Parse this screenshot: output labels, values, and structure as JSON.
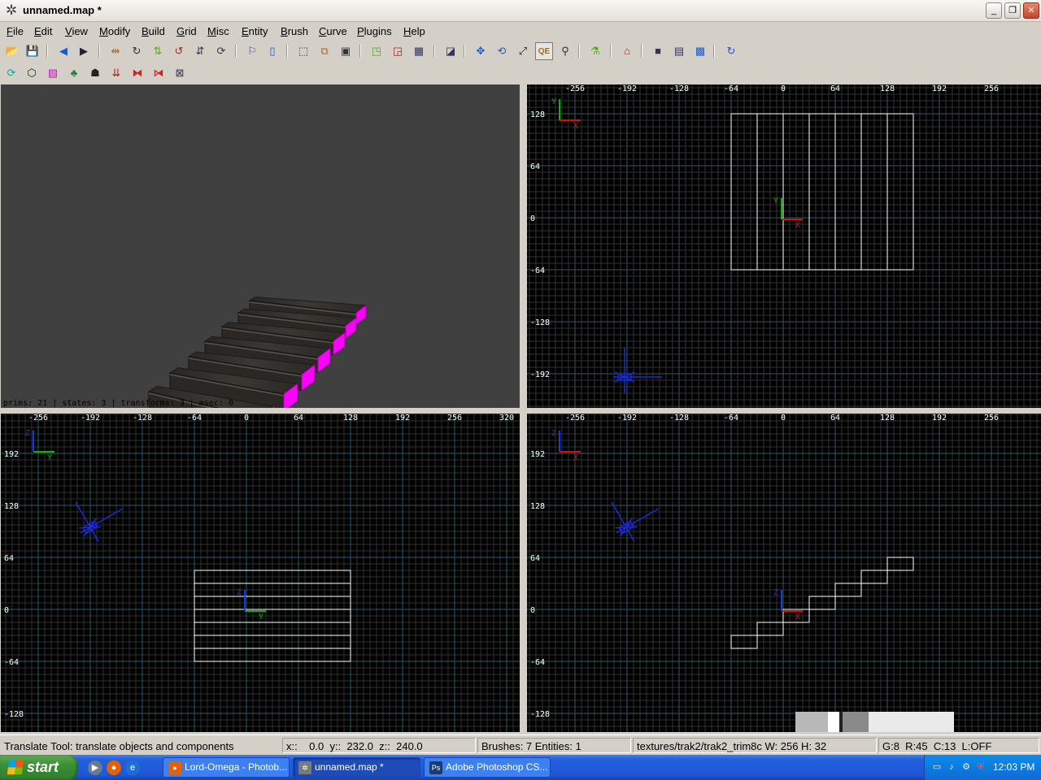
{
  "window": {
    "title": "unnamed.map *",
    "app_icon": "gear-icon",
    "controls": {
      "minimize": "_",
      "maximize": "❐",
      "close": "✕"
    }
  },
  "menu": [
    "File",
    "Edit",
    "View",
    "Modify",
    "Build",
    "Grid",
    "Misc",
    "Entity",
    "Brush",
    "Curve",
    "Plugins",
    "Help"
  ],
  "toolbar1": [
    {
      "name": "open-icon",
      "glyph": "📂"
    },
    {
      "name": "save-icon",
      "glyph": "💾"
    },
    {
      "name": "undo-arrow-icon",
      "glyph": "◀"
    },
    {
      "name": "redo-arrow-icon",
      "glyph": "▶"
    },
    {
      "name": "flip-x-icon",
      "glyph": "⇹"
    },
    {
      "name": "rotate-x-icon",
      "glyph": "↻"
    },
    {
      "name": "flip-y-icon",
      "glyph": "⇅"
    },
    {
      "name": "rotate-y-icon",
      "glyph": "↺"
    },
    {
      "name": "flip-z-icon",
      "glyph": "⇵"
    },
    {
      "name": "rotate-z-icon",
      "glyph": "⟳"
    },
    {
      "name": "make-hollow-icon",
      "glyph": "⚐"
    },
    {
      "name": "entity-icon",
      "glyph": "▯"
    },
    {
      "name": "select-inside-icon",
      "glyph": "⬚"
    },
    {
      "name": "select-touching-icon",
      "glyph": "⧉"
    },
    {
      "name": "select-partial-icon",
      "glyph": "▣"
    },
    {
      "name": "clipper-icon",
      "glyph": "◳"
    },
    {
      "name": "csg-subtract-icon",
      "glyph": "◲"
    },
    {
      "name": "csg-merge-icon",
      "glyph": "▦"
    },
    {
      "name": "texture-lock-icon",
      "glyph": "◪"
    },
    {
      "name": "translate-tool-icon",
      "glyph": "✥"
    },
    {
      "name": "rotate-tool-icon",
      "glyph": "⟲"
    },
    {
      "name": "scale-tool-icon",
      "glyph": "⤢"
    },
    {
      "name": "qe-tool-button",
      "glyph": "QE"
    },
    {
      "name": "vertex-tool-icon",
      "glyph": "⚲"
    },
    {
      "name": "plugin-icon",
      "glyph": "⚗"
    },
    {
      "name": "home-icon",
      "glyph": "⌂"
    },
    {
      "name": "cube-icon",
      "glyph": "■"
    },
    {
      "name": "document-icon",
      "glyph": "▤"
    },
    {
      "name": "texture-icon",
      "glyph": "▩"
    },
    {
      "name": "refresh-icon",
      "glyph": "↻"
    }
  ],
  "toolbar2": [
    {
      "name": "cycle-icon",
      "glyph": "⟳"
    },
    {
      "name": "patch-icon",
      "glyph": "⬡"
    },
    {
      "name": "shader-icon",
      "glyph": "▨"
    },
    {
      "name": "tree-icon",
      "glyph": "♣"
    },
    {
      "name": "cap-icon",
      "glyph": "☗"
    },
    {
      "name": "thicken-icon",
      "glyph": "⇊"
    },
    {
      "name": "mirror-x-icon",
      "glyph": "⧓"
    },
    {
      "name": "mirror-y-icon",
      "glyph": "⧒"
    },
    {
      "name": "invert-icon",
      "glyph": "⊠"
    }
  ],
  "viewport_3d": {
    "stats": "prims: 21 | states: 3 | transforms: 3 | msec: 0"
  },
  "view_top": {
    "x_ticks": [
      "-256",
      "-192",
      "-128",
      "-64",
      "0",
      "64",
      "128",
      "192",
      "256"
    ],
    "y_ticks": [
      "128",
      "64",
      "0",
      "-64",
      "-128",
      "-192"
    ],
    "axis_h": "X",
    "axis_v": "Y"
  },
  "view_front": {
    "x_ticks": [
      "-256",
      "-192",
      "-128",
      "-64",
      "0",
      "64",
      "128",
      "192",
      "256",
      "320"
    ],
    "y_ticks": [
      "192",
      "128",
      "64",
      "0",
      "-64",
      "-128"
    ],
    "axis_h": "Y",
    "axis_v": "Z"
  },
  "view_side": {
    "x_ticks": [
      "-256",
      "-192",
      "-128",
      "-64",
      "0",
      "64",
      "128",
      "192",
      "256"
    ],
    "y_ticks": [
      "192",
      "128",
      "64",
      "0",
      "-64",
      "-128"
    ],
    "axis_h": "X",
    "axis_v": "Z"
  },
  "status": {
    "tool": "Translate Tool: translate objects and components",
    "coords": "x::    0.0  y::  232.0  z::  240.0",
    "counts": "Brushes: 7 Entities: 1",
    "texture": "textures/trak2/trak2_trim8c W: 256 H: 32",
    "grid": "G:8  R:45  C:13  L:OFF"
  },
  "taskbar": {
    "start": "start",
    "quicklaunch": [
      "media-player-icon",
      "firefox-icon",
      "internet-explorer-icon"
    ],
    "tasks": [
      {
        "label": "Lord-Omega - Photob...",
        "icon": "firefox-icon",
        "active": false
      },
      {
        "label": "unnamed.map *",
        "icon": "gear-icon",
        "active": true
      },
      {
        "label": "Adobe Photoshop CS...",
        "icon": "photoshop-icon",
        "active": false
      }
    ],
    "tray_icons": [
      "network-icon",
      "volume-icon",
      "security-icon",
      "shield-icon"
    ],
    "clock": "12:03 PM"
  },
  "colors": {
    "grid_minor": "#313131",
    "grid_major": "#1f5f66",
    "brush": "#ffffff",
    "axis_x": "#d01010",
    "axis_y": "#10b010",
    "axis_z": "#1a3ad8",
    "camera": "#1a2ad8",
    "stair_magenta": "#ff00ff"
  }
}
